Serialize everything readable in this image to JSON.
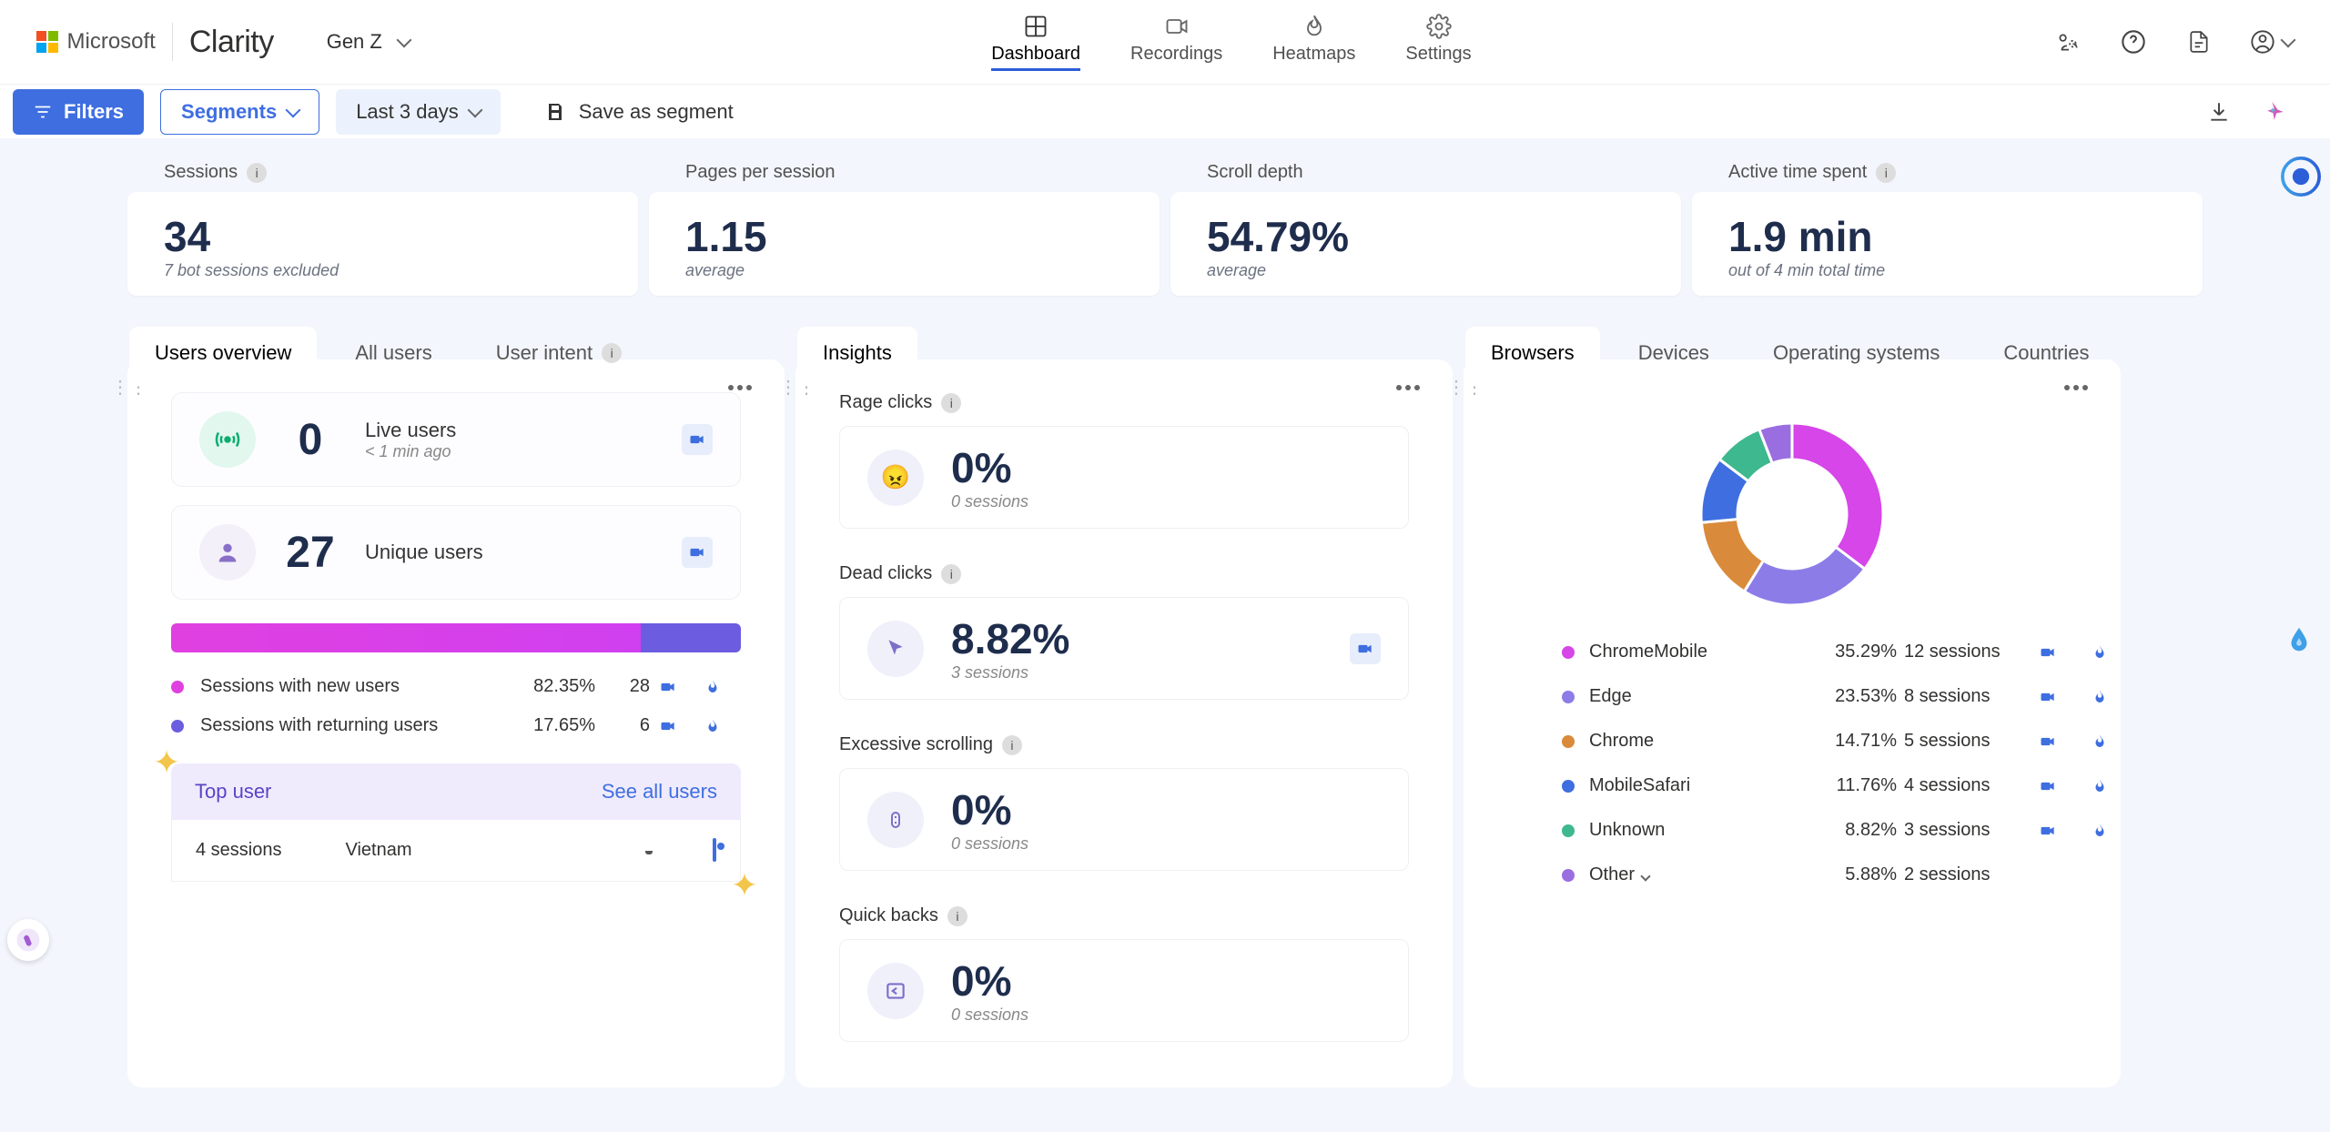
{
  "header": {
    "ms": "Microsoft",
    "product": "Clarity",
    "project": "Gen Z",
    "nav": {
      "dashboard": "Dashboard",
      "recordings": "Recordings",
      "heatmaps": "Heatmaps",
      "settings": "Settings"
    }
  },
  "toolbar": {
    "filters": "Filters",
    "segments": "Segments",
    "date": "Last 3 days",
    "save": "Save as segment"
  },
  "metrics": {
    "sessions": {
      "label": "Sessions",
      "value": "34",
      "sub": "7 bot sessions excluded"
    },
    "pps": {
      "label": "Pages per session",
      "value": "1.15",
      "sub": "average"
    },
    "scroll": {
      "label": "Scroll depth",
      "value": "54.79%",
      "sub": "average"
    },
    "active": {
      "label": "Active time spent",
      "value": "1.9 min",
      "sub": "out of 4 min total time"
    }
  },
  "users_card": {
    "tabs": {
      "overview": "Users overview",
      "all": "All users",
      "intent": "User intent"
    },
    "live": {
      "count": "0",
      "label": "Live users",
      "sub": "< 1 min ago"
    },
    "unique": {
      "count": "27",
      "label": "Unique users"
    },
    "bar": {
      "new_pct": 82.35,
      "ret_pct": 17.65
    },
    "legend": {
      "new": {
        "text": "Sessions with new users",
        "pct": "82.35%",
        "n": "28"
      },
      "ret": {
        "text": "Sessions with returning users",
        "pct": "17.65%",
        "n": "6"
      }
    },
    "topuser": {
      "title": "Top user",
      "see": "See all users",
      "sessions": "4 sessions",
      "country": "Vietnam"
    }
  },
  "insights_card": {
    "title": "Insights",
    "rage": {
      "label": "Rage clicks",
      "value": "0%",
      "sub": "0 sessions"
    },
    "dead": {
      "label": "Dead clicks",
      "value": "8.82%",
      "sub": "3 sessions"
    },
    "scroll": {
      "label": "Excessive scrolling",
      "value": "0%",
      "sub": "0 sessions"
    },
    "quick": {
      "label": "Quick backs",
      "value": "0%",
      "sub": "0 sessions"
    }
  },
  "browsers_card": {
    "tabs": {
      "browsers": "Browsers",
      "devices": "Devices",
      "os": "Operating systems",
      "countries": "Countries"
    },
    "rows": [
      {
        "name": "ChromeMobile",
        "pct": "35.29%",
        "sess": "12 sessions",
        "color": "#d646e8"
      },
      {
        "name": "Edge",
        "pct": "23.53%",
        "sess": "8 sessions",
        "color": "#8b7ce8"
      },
      {
        "name": "Chrome",
        "pct": "14.71%",
        "sess": "5 sessions",
        "color": "#d98a3a"
      },
      {
        "name": "MobileSafari",
        "pct": "11.76%",
        "sess": "4 sessions",
        "color": "#3e6ee0"
      },
      {
        "name": "Unknown",
        "pct": "8.82%",
        "sess": "3 sessions",
        "color": "#3eb88e"
      },
      {
        "name": "Other",
        "pct": "5.88%",
        "sess": "2 sessions",
        "color": "#9a6ee0"
      }
    ]
  },
  "chart_data": {
    "type": "pie",
    "title": "Browsers",
    "series": [
      {
        "name": "ChromeMobile",
        "value": 35.29,
        "sessions": 12
      },
      {
        "name": "Edge",
        "value": 23.53,
        "sessions": 8
      },
      {
        "name": "Chrome",
        "value": 14.71,
        "sessions": 5
      },
      {
        "name": "MobileSafari",
        "value": 11.76,
        "sessions": 4
      },
      {
        "name": "Unknown",
        "value": 8.82,
        "sessions": 3
      },
      {
        "name": "Other",
        "value": 5.88,
        "sessions": 2
      }
    ]
  }
}
